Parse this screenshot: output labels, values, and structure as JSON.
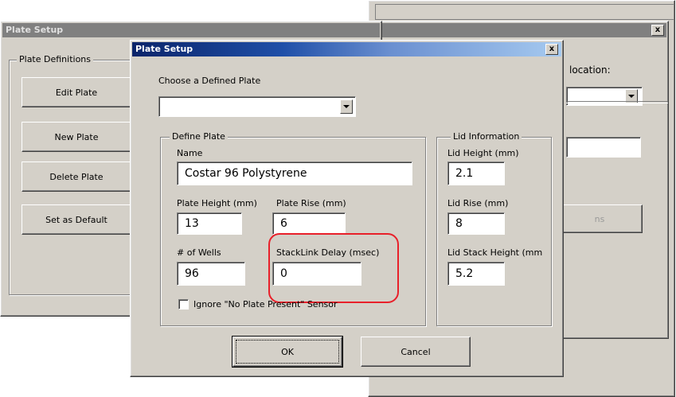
{
  "colors": {
    "title_active_start": "#0a246a",
    "title_active_end": "#a6caf0",
    "title_inactive": "#808080",
    "face": "#d4d0c8",
    "highlight_ring": "#e8202a"
  },
  "back_window": {
    "close_label": "x",
    "location_label": "location:",
    "partial_button_label": "ns"
  },
  "plate_setup_back": {
    "title": "Plate Setup",
    "group_label": "Plate Definitions",
    "buttons": [
      "Edit Plate",
      "New Plate",
      "Delete Plate",
      "Set as Default"
    ]
  },
  "dialog": {
    "title": "Plate Setup",
    "close_label": "x",
    "choose_label": "Choose a Defined Plate",
    "choose_value": "",
    "define_group": "Define Plate",
    "name_label": "Name",
    "name_value": "Costar 96 Polystyrene",
    "plate_height_label": "Plate Height (mm)",
    "plate_height_value": "13",
    "plate_rise_label": "Plate Rise (mm)",
    "plate_rise_value": "6",
    "wells_label": "# of Wells",
    "wells_value": "96",
    "stacklink_label": "StackLink Delay (msec)",
    "stacklink_value": "0",
    "ignore_label": "Ignore \"No Plate Present\" Sensor",
    "ignore_checked": false,
    "lid_group": "Lid Information",
    "lid_height_label": "Lid Height (mm)",
    "lid_height_value": "2.1",
    "lid_rise_label": "Lid Rise (mm)",
    "lid_rise_value": "8",
    "lid_stack_label": "Lid Stack Height (mm",
    "lid_stack_value": "5.2",
    "ok_label": "OK",
    "cancel_label": "Cancel"
  }
}
